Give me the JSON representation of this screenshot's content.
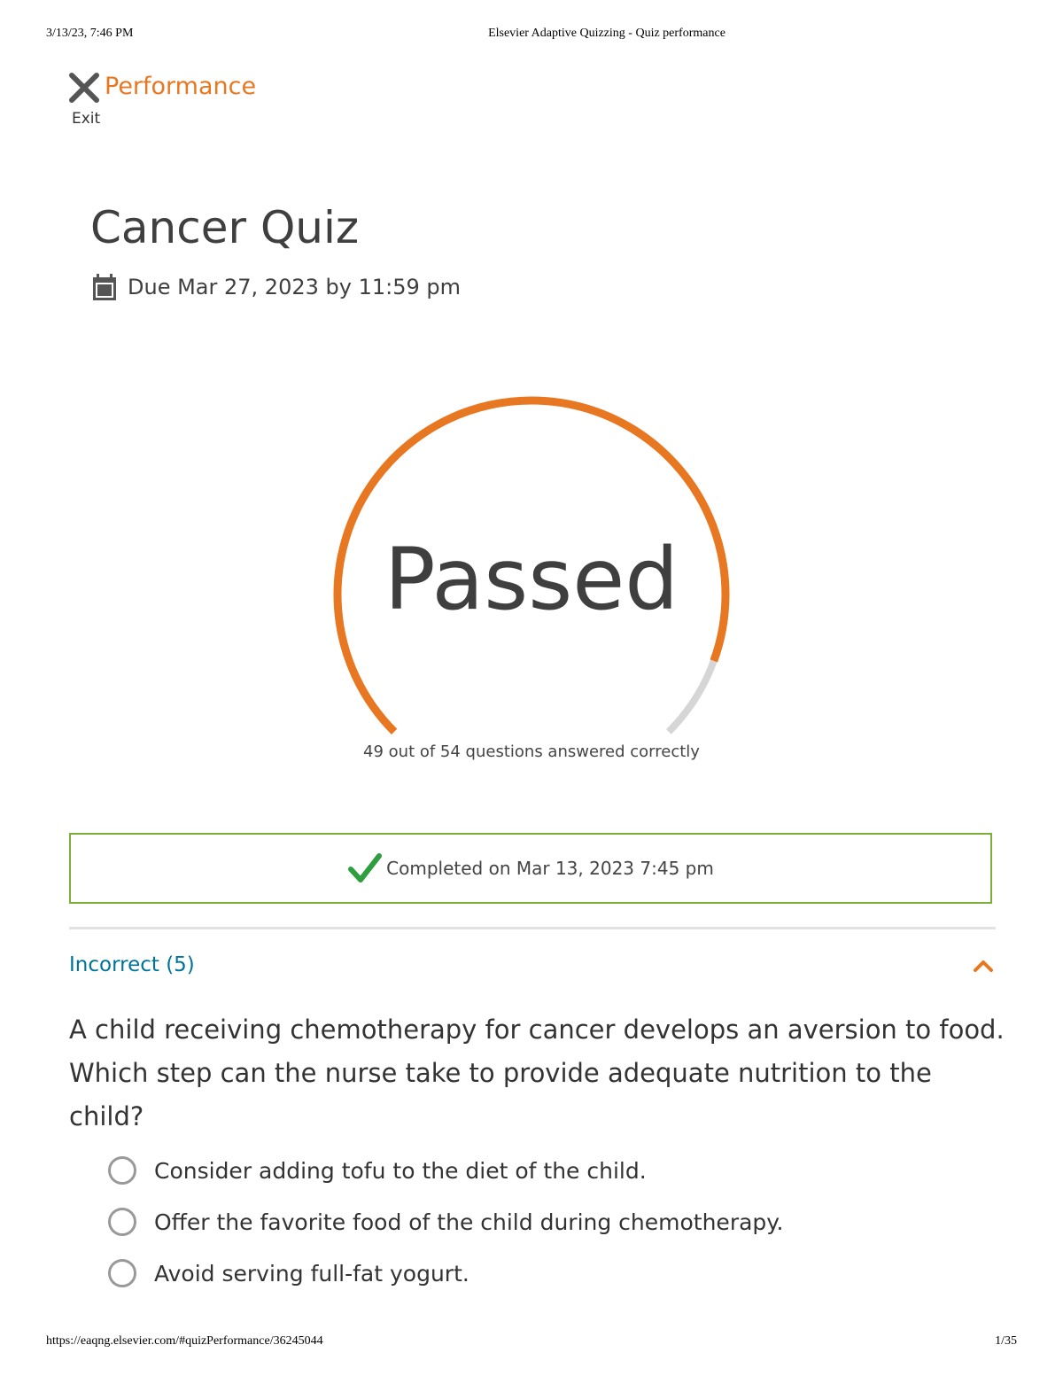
{
  "print_header": {
    "datetime": "3/13/23, 7:46 PM",
    "page_title": "Elsevier Adaptive Quizzing - Quiz performance"
  },
  "print_footer": {
    "url": "https://eaqng.elsevier.com/#quizPerformance/36245044",
    "page": "1/35"
  },
  "header": {
    "exit_label": "Exit",
    "title": "Performance"
  },
  "quiz": {
    "title": "Cancer Quiz",
    "due": "Due Mar 27, 2023 by 11:59 pm"
  },
  "result": {
    "status": "Passed",
    "correct": 49,
    "total": 54,
    "caption": "49 out of 54 questions answered correctly"
  },
  "completion": {
    "text": "Completed on Mar 13, 2023 7:45 pm"
  },
  "section": {
    "label": "Incorrect (5)",
    "expanded": true
  },
  "question": {
    "text": "A child receiving chemotherapy for cancer develops an aversion to food. Which step can the nurse take to provide adequate nutrition to the child?",
    "options": [
      "Consider adding tofu to the diet of the child.",
      "Offer the favorite food of the child during chemotherapy.",
      "Avoid serving full-fat yogurt."
    ]
  },
  "colors": {
    "accent": "#e87722",
    "progress_track": "#d6d6d6",
    "success_border": "#7cae39",
    "check": "#2e9e3e",
    "link": "#007398"
  },
  "icons": {
    "exit": "close-icon",
    "due": "calendar-icon",
    "completed": "checkmark-icon",
    "section_toggle": "chevron-up-icon",
    "option": "radio-circle-icon"
  }
}
